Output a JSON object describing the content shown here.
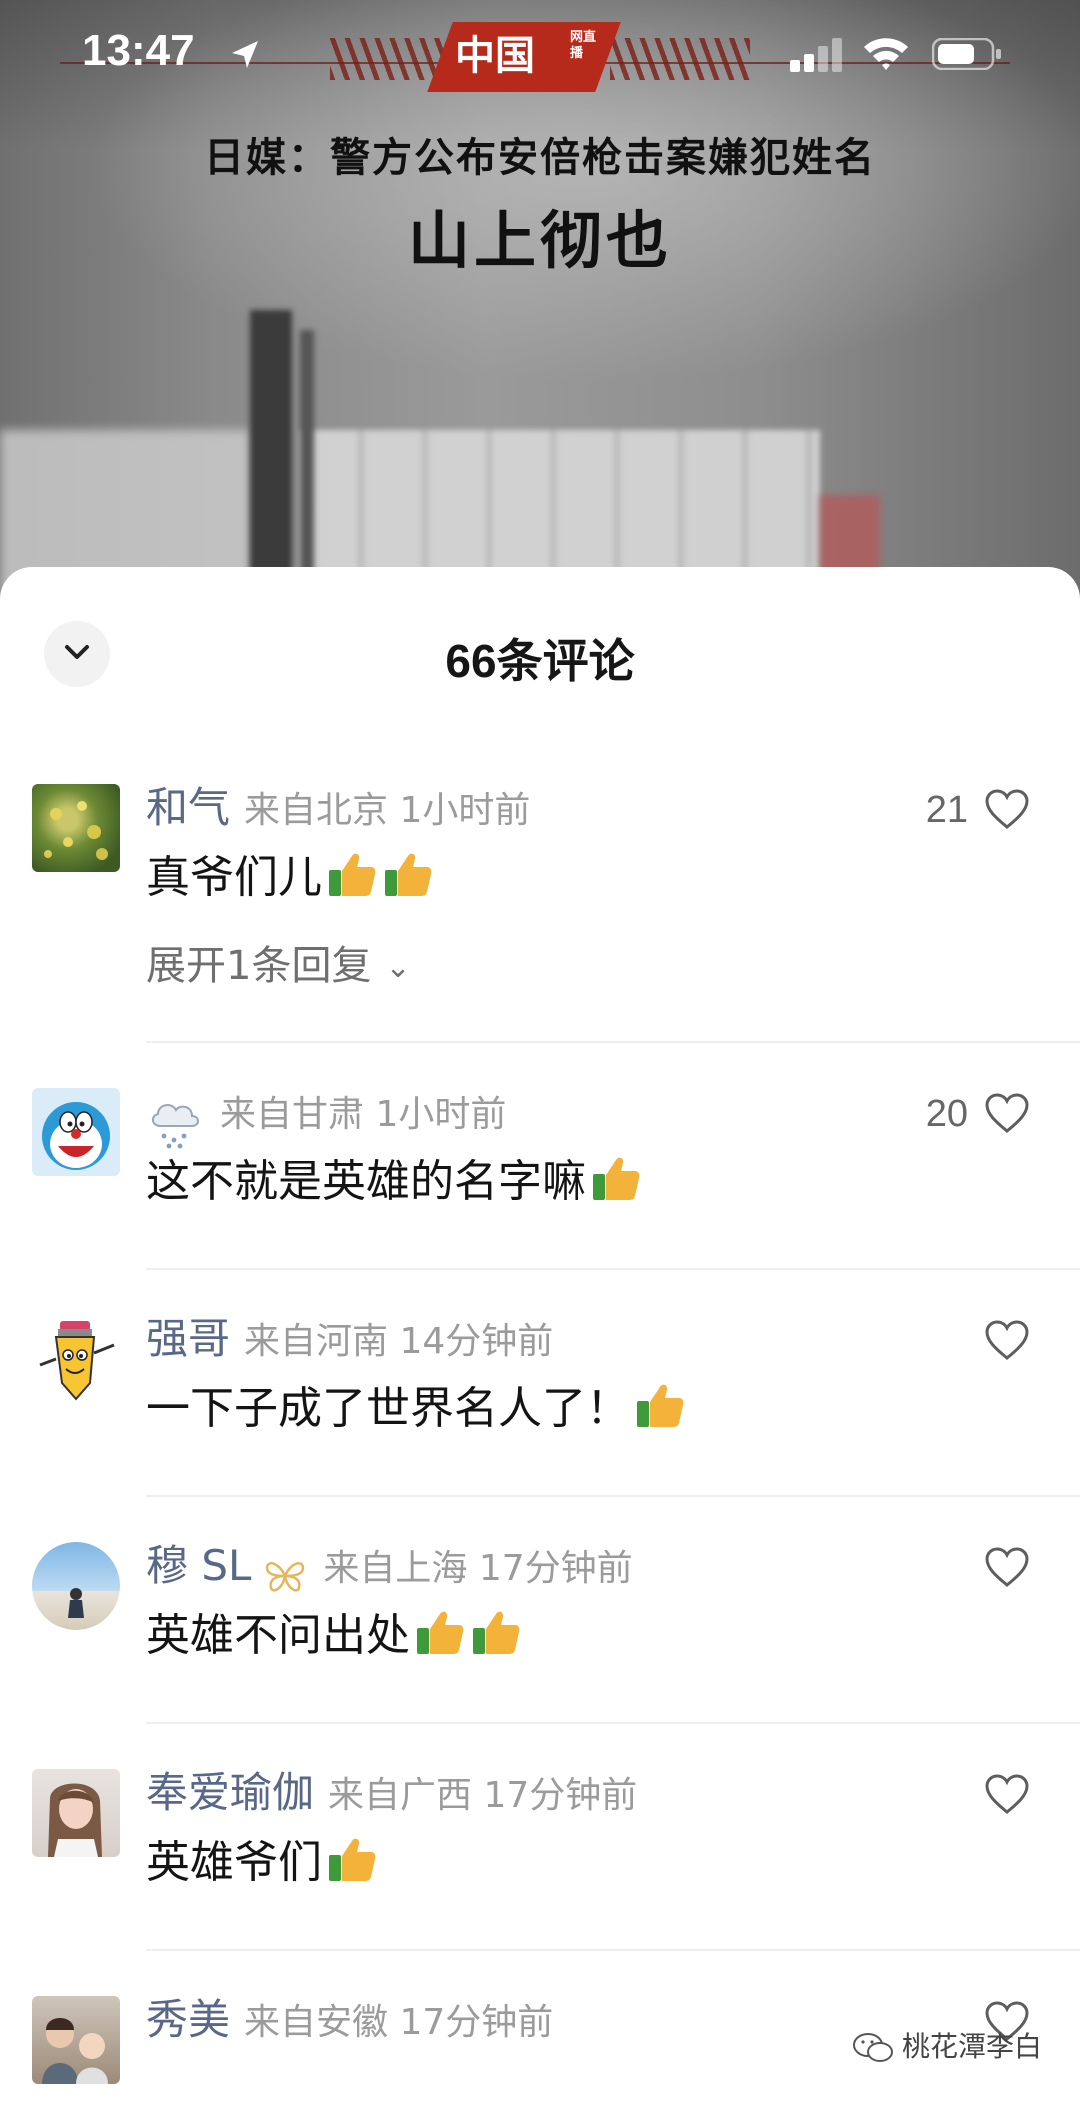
{
  "status_bar": {
    "time": "13:47"
  },
  "video": {
    "logo_text": "中国",
    "logo_sub": "网直播",
    "headline": "日媒：警方公布安倍枪击案嫌犯姓名",
    "subheadline": "山上彻也"
  },
  "comments_sheet": {
    "title": "66条评论",
    "comments": [
      {
        "username": "和气",
        "location_time": "来自北京 1小时前",
        "text": "真爷们儿",
        "thumbs": 2,
        "likes": "21",
        "expand_label": "展开1条回复"
      },
      {
        "username": "",
        "username_icon": "snow-cloud-icon",
        "location_time": "来自甘肃 1小时前",
        "text": "这不就是英雄的名字嘛",
        "thumbs": 1,
        "likes": "20"
      },
      {
        "username": "强哥",
        "location_time": "来自河南 14分钟前",
        "text": "一下子成了世界名人了！",
        "thumbs": 1,
        "likes": ""
      },
      {
        "username": "穆 SL",
        "username_badge": "butterfly-badge-icon",
        "location_time": "来自上海 17分钟前",
        "text": "英雄不问出处",
        "thumbs": 2,
        "likes": ""
      },
      {
        "username": "奉爱瑜伽",
        "location_time": "来自广西 17分钟前",
        "text": "英雄爷们",
        "thumbs": 1,
        "likes": ""
      },
      {
        "username": "秀美",
        "location_time": "来自安徽 17分钟前",
        "text": "",
        "thumbs": 0,
        "likes": ""
      }
    ]
  },
  "watermark": {
    "text": "桃花潭李白"
  },
  "colors": {
    "username": "#5a6887",
    "meta": "#9b9b9b",
    "logo_red": "#b62a1c"
  }
}
